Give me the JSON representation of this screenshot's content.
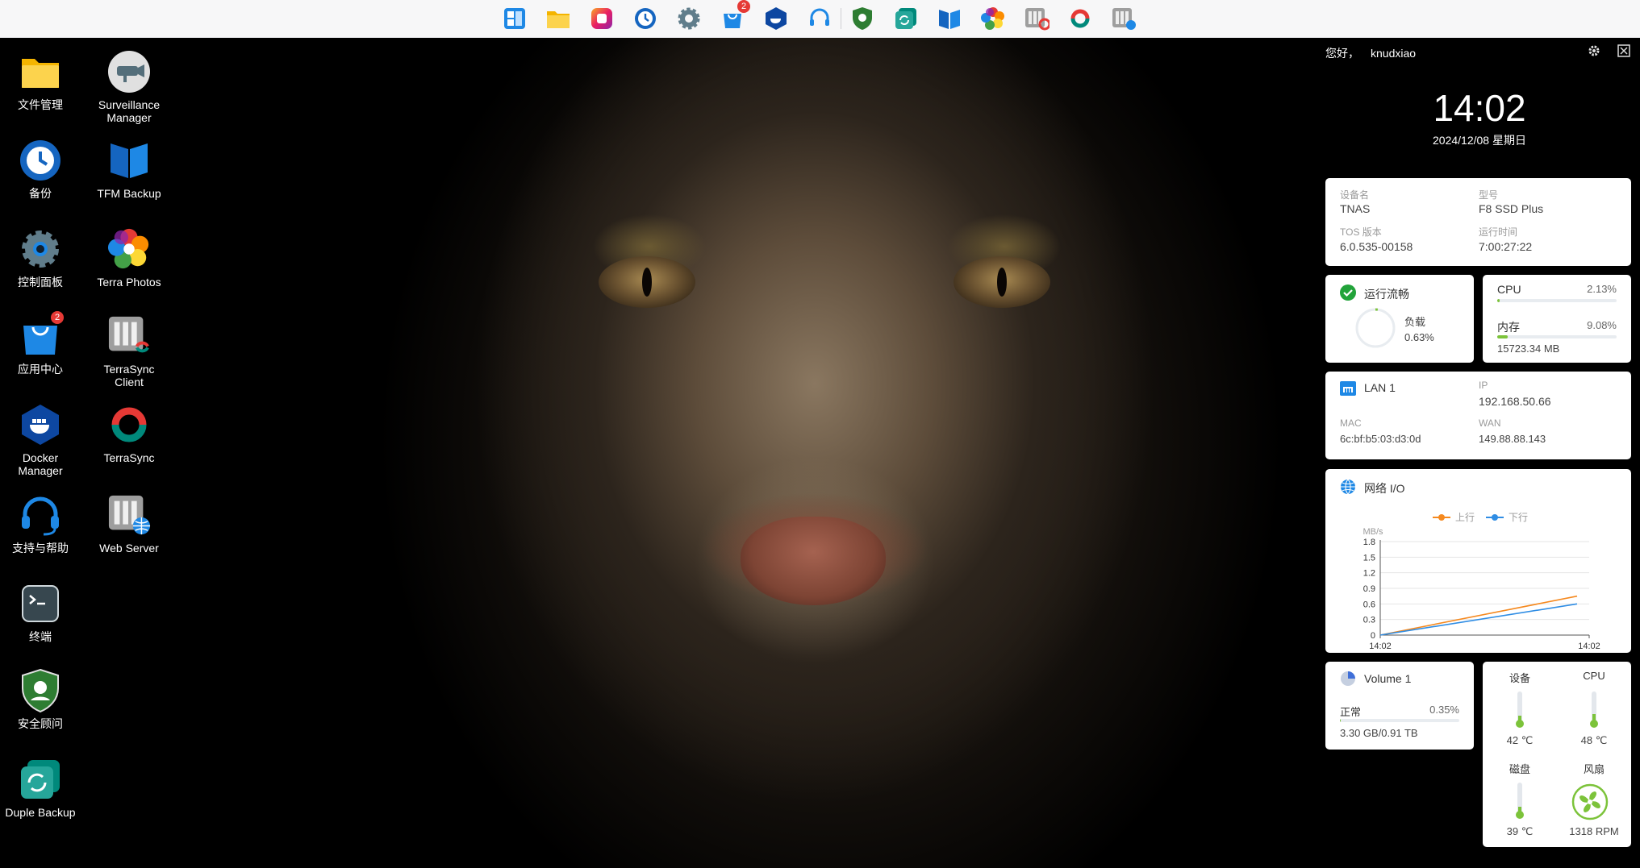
{
  "dock": [
    {
      "name": "start-menu-icon"
    },
    {
      "name": "file-manager-icon"
    },
    {
      "name": "photos-app-icon"
    },
    {
      "name": "backup-icon"
    },
    {
      "name": "settings-icon"
    },
    {
      "name": "app-center-icon",
      "badge": "2"
    },
    {
      "name": "docker-icon"
    },
    {
      "name": "support-icon"
    },
    {
      "name": "security-advisor-icon"
    },
    {
      "name": "duple-backup-icon"
    },
    {
      "name": "tfm-backup-icon"
    },
    {
      "name": "terra-photos-icon"
    },
    {
      "name": "terrasync-client-icon"
    },
    {
      "name": "terrasync-icon"
    },
    {
      "name": "web-server-icon"
    }
  ],
  "desktop": {
    "file_manager": "文件管理",
    "surveillance": "Surveillance\nManager",
    "backup": "备份",
    "tfm_backup": "TFM Backup",
    "control_panel": "控制面板",
    "terra_photos": "Terra Photos",
    "app_center": "应用中心",
    "app_center_badge": "2",
    "terrasync_client": "TerraSync\nClient",
    "docker": "Docker\nManager",
    "terrasync": "TerraSync",
    "support": "支持与帮助",
    "web_server": "Web Server",
    "terminal": "终端",
    "security": "安全顾问",
    "duple_backup": "Duple Backup"
  },
  "header": {
    "greeting": "您好，",
    "username": "knudxiao"
  },
  "clock": {
    "time": "14:02",
    "date": "2024/12/08 星期日"
  },
  "device": {
    "name_label": "设备名",
    "name": "TNAS",
    "model_label": "型号",
    "model": "F8 SSD Plus",
    "tos_label": "TOS 版本",
    "tos": "6.0.535-00158",
    "uptime_label": "运行时间",
    "uptime": "7:00:27:22"
  },
  "status": {
    "title": "运行流畅",
    "load_label": "负载",
    "load": "0.63%",
    "load_fraction": 0.0063
  },
  "resources": {
    "cpu_label": "CPU",
    "cpu": "2.13%",
    "cpu_fraction": 0.0213,
    "mem_label": "内存",
    "mem": "9.08%",
    "mem_fraction": 0.0908,
    "mem_size": "15723.34 MB"
  },
  "network": {
    "title": "LAN 1",
    "ip_label": "IP",
    "ip": "192.168.50.66",
    "mac_label": "MAC",
    "mac": "6c:bf:b5:03:d3:0d",
    "wan_label": "WAN",
    "wan": "149.88.88.143"
  },
  "netio": {
    "title": "网络 I/O"
  },
  "chart_data": {
    "type": "line",
    "title": "网络 I/O",
    "ylabel": "MB/s",
    "ylim": [
      0,
      1.8
    ],
    "yticks": [
      "1.8",
      "1.5",
      "1.2",
      "0.9",
      "0.6",
      "0.3",
      "0"
    ],
    "x": [
      "14:02",
      "14:02"
    ],
    "legend_position": "top-center",
    "grid": true,
    "series": [
      {
        "name": "上行",
        "color": "#f5891f",
        "values": [
          0,
          0.75
        ]
      },
      {
        "name": "下行",
        "color": "#2f8de4",
        "values": [
          0,
          0.6
        ]
      }
    ]
  },
  "volume": {
    "title": "Volume 1",
    "status": "正常",
    "percent": "0.35%",
    "fraction": 0.0035,
    "usage": "3.30 GB/0.91 TB"
  },
  "temps": {
    "device_label": "设备",
    "device": "42 ℃",
    "device_level": 0.42,
    "cpu_label": "CPU",
    "cpu": "48 ℃",
    "cpu_level": 0.48,
    "disk_label": "磁盘",
    "disk": "39 ℃",
    "disk_level": 0.39,
    "fan_label": "风扇",
    "fan": "1318 RPM"
  },
  "colors": {
    "accent_green": "#7cc33a",
    "brand_blue": "#1e88e5"
  }
}
